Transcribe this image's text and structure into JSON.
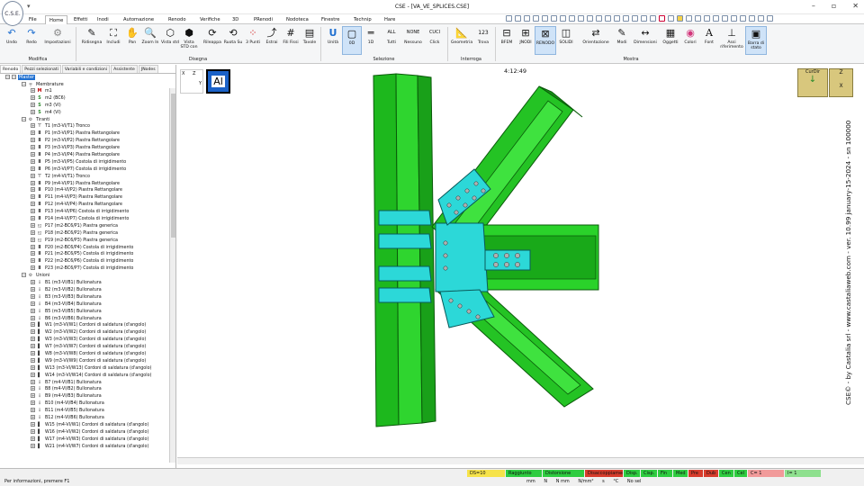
{
  "window": {
    "title": "CSE - [VA_VE_SPLICES.CSE]",
    "logo": "C.S.E."
  },
  "menu": {
    "tabs": [
      "File",
      "Home",
      "Effetti",
      "Inodi",
      "Automazione",
      "Renodo",
      "Verifiche",
      "3D",
      "PRenodi",
      "Nodoteca",
      "Finestre",
      "Technip",
      "Hare"
    ],
    "active": "Home"
  },
  "ribbon": {
    "modifica": {
      "label": "Modifica",
      "undo": "Undo",
      "redo": "Redo",
      "impostazioni": "Impostazioni"
    },
    "disegna": {
      "label": "Disegna",
      "ridisegna": "Ridisegna",
      "includi": "Includi",
      "pan": "Pan",
      "zoom": "Zoom In",
      "vista_std": "Vista std",
      "vista_std_con": "Vista STD con",
      "rileggi": "Rileappa",
      "ruota": "Ruota Su",
      "punti3": "3 Punti",
      "estrai": "Estrai",
      "fili_fissi": "Fili Fissi",
      "tavole": "Tavole"
    },
    "selezione": {
      "label": "Selezione",
      "unita": "Unità",
      "b0d": "0D",
      "b1d": "1D",
      "all": "ALL",
      "tutti": "Tutti",
      "none": "NONE",
      "nessuno": "Nessuno",
      "cuci": "CUCI",
      "click": "Click"
    },
    "interroga": {
      "label": "Interroga",
      "geometria": "Geometria",
      "trova": "Trova",
      "num": "123"
    },
    "mostra": {
      "label": "Mostra",
      "bfem": "BFEM",
      "jnodi": "JNODI",
      "renodo": "RENODO",
      "solidi": "SOLIDI",
      "orientazione": "Orientazione",
      "modi": "Modi",
      "dimensioni": "Dimensioni",
      "oggetti": "Oggetti",
      "colori": "Colori",
      "font": "Font",
      "assi": "Assi riferimento",
      "barra": "Barra di stato"
    }
  },
  "panel": {
    "tabs": [
      "Renodo",
      "Pezzi selezionati",
      "Variabili e condizioni",
      "Assistente",
      "JNodes"
    ],
    "root": "Master",
    "groups": {
      "membrature": "Membrature",
      "tiranti": "Tiranti",
      "unioni": "Unioni"
    },
    "membrature": [
      {
        "icon": "M",
        "label": "m1",
        "color": "#c00000"
      },
      {
        "icon": "S",
        "label": "m2 (BC6)",
        "color": "#2a8a2a"
      },
      {
        "icon": "S",
        "label": "m3 (VI)",
        "color": "#2a8a2a"
      },
      {
        "icon": "S",
        "label": "m4 (VI)",
        "color": "#2a8a2a"
      }
    ],
    "tiranti": [
      "T1 (m3-VI/T1)  Tronco",
      "P1 (m3-VI/P1)  Piastra Rettangolare",
      "P2 (m3-VI/P2)  Piastra Rettangolare",
      "P3 (m3-VI/P3)  Piastra Rettangolare",
      "P4 (m3-VI/P4)  Piastra Rettangolare",
      "P5 (m3-VI/P5)  Costola di irrigidimento",
      "P6 (m3-VI/P7)  Costola di irrigidimento",
      "T2 (m4-VI/T1)  Tronco",
      "P9 (m4-VI/P1)  Piastra Rettangolare",
      "P10 (m4-VI/P2)  Piastra Rettangolare",
      "P11 (m4-VI/P3)  Piastra Rettangolare",
      "P12 (m4-VI/P4)  Piastra Rettangolare",
      "P13 (m4-VI/P6)  Costola di irrigidimento",
      "P14 (m4-VI/P7)  Costola di irrigidimento",
      "P17 (m2-BC6/P1)  Piastra generica",
      "P18 (m2-BC6/P2)  Piastra generica",
      "P19 (m2-BC6/P3)  Piastra generica",
      "P20 (m2-BC6/P4)  Costola di irrigidimento",
      "P21 (m2-BC6/P5)  Costola di irrigidimento",
      "P22 (m2-BC6/P6)  Costola di irrigidimento",
      "P23 (m2-BC6/P7)  Costola di irrigidimento"
    ],
    "unioni": [
      "B1 (m3-VI/B1)  Bullonatura",
      "B2 (m3-VI/B2)  Bullonatura",
      "B3 (m3-VI/B3)  Bullonatura",
      "B4 (m3-VI/B4)  Bullonatura",
      "B5 (m3-VI/B5)  Bullonatura",
      "B6 (m3-VI/B6)  Bullonatura",
      "W1 (m3-VI/W1)  Cordoni di saldatura (d'angolo)",
      "W2 (m3-VI/W2)  Cordoni di saldatura (d'angolo)",
      "W3 (m3-VI/W3)  Cordoni di saldatura (d'angolo)",
      "W7 (m3-VI/W7)  Cordoni di saldatura (d'angolo)",
      "W8 (m3-VI/W8)  Cordoni di saldatura (d'angolo)",
      "W9 (m3-VI/W9)  Cordoni di saldatura (d'angolo)",
      "W13 (m3-VI/W13)  Cordoni di saldatura (d'angolo)",
      "W14 (m3-VI/W14)  Cordoni di saldatura (d'angolo)",
      "B7 (m4-VI/B1)  Bullonatura",
      "B8 (m4-VI/B2)  Bullonatura",
      "B9 (m4-VI/B3)  Bullonatura",
      "B10 (m4-VI/B4)  Bullonatura",
      "B11 (m4-VI/B5)  Bullonatura",
      "B12 (m4-VI/B6)  Bullonatura",
      "W15 (m4-VI/W1)  Cordoni di saldatura (d'angolo)",
      "W16 (m4-VI/W2)  Cordoni di saldatura (d'angolo)",
      "W17 (m4-VI/W3)  Cordoni di saldatura (d'angolo)",
      "W21 (m4-VI/W7)  Cordoni di saldatura (d'angolo)"
    ]
  },
  "viewport": {
    "clock": "4:12:49",
    "al_label": "Al",
    "axis_z": "Z",
    "axis_x": "X",
    "axis_y": "Y",
    "curdir": "CurDir",
    "zlabel": "Z",
    "xlabel": "X",
    "credit": "CSE© - by Castalia srl - www.castaliaweb.com - ver. 10.99 january-15-2024 - sn 100000"
  },
  "status": {
    "help": "Per informazioni, premere F1",
    "cells": [
      {
        "t": "DS=10",
        "c": "#f6e34a"
      },
      {
        "t": "Raggiunto",
        "c": "#2ecc40"
      },
      {
        "t": "Distorsione",
        "c": "#2ecc40"
      },
      {
        "t": "Disaccoppiamento",
        "c": "#d73c2c"
      },
      {
        "t": "Disp.",
        "c": "#2ecc40"
      },
      {
        "t": "Cisp.",
        "c": "#2ecc40"
      },
      {
        "t": "Fin",
        "c": "#2ecc40"
      },
      {
        "t": "Med",
        "c": "#2ecc40"
      },
      {
        "t": "Pre",
        "c": "#d73c2c"
      },
      {
        "t": "Dub",
        "c": "#d73c2c"
      },
      {
        "t": "Cen",
        "c": "#2ecc40"
      },
      {
        "t": "Cel",
        "c": "#2ecc40"
      },
      {
        "t": "C= 1",
        "c": "#f19a9a"
      },
      {
        "t": "I= 1",
        "c": "#8ee08e"
      }
    ],
    "units": [
      "mm",
      "N",
      "N mm",
      "N/mm²",
      "s",
      "°C",
      "No sel"
    ]
  }
}
